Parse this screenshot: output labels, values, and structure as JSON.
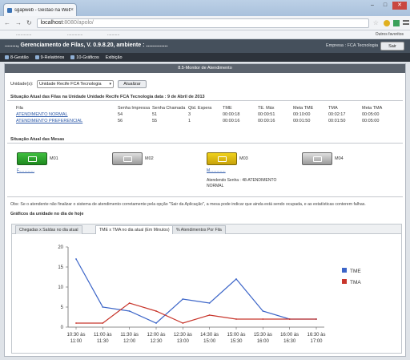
{
  "browser": {
    "tab_title": "sgapweb - Gestão na Web",
    "url_host": "localhost",
    "url_path": ":8080/apolo/",
    "bookmarks": [
      "..............",
      "..............",
      "..........."
    ],
    "other_bookmarks": "Outros favoritos"
  },
  "app": {
    "title": "........, Gerenciamento de Filas, V. 0.9.8.20, ambiente : ..............",
    "empresa": "Empresa : FCA Tecnologia",
    "sair": "Sair",
    "menu": [
      "8-Gestão",
      "9-Relatórios",
      "10-Gráficos",
      "Exibição"
    ]
  },
  "section_title": "8.5-Monitor de Atendimento",
  "filters": {
    "unidade_label": "Unidade(s):",
    "unidade_value": "Unidade Recife FCA Tecnologia",
    "atualizar": "Atualizar"
  },
  "queues": {
    "heading": "Situação Atual das Filas na Unidade Unidade Recife FCA Tecnologia data : 9 de Abril de 2013",
    "headers": [
      "Fila",
      "Senha Impressa",
      "Senha Chamada",
      "Qtd. Espera",
      "TME",
      "TE. Máx",
      "Meta TME",
      "TMA",
      "Meta TMA"
    ],
    "rows": [
      [
        "ATENDIMENTO NORMAL",
        "54",
        "51",
        "3",
        "00:00:18",
        "00:00:51",
        "00:10:00",
        "00:02:17",
        "00:05:00"
      ],
      [
        "ATENDIMENTO PREFERENCIAL",
        "56",
        "55",
        "1",
        "00:00:16",
        "00:00:16",
        "00:01:50",
        "00:01:50",
        "00:05:00"
      ]
    ]
  },
  "desks": {
    "heading": "Situação Atual das Mesas",
    "items": [
      {
        "name": "M01",
        "status": "free",
        "link": "F.............."
      },
      {
        "name": "M02",
        "status": "off",
        "link": ""
      },
      {
        "name": "M03",
        "status": "busy",
        "link": "M..............",
        "info": "Atendendo Senha : 48-ATENDIMENTO NORMAL"
      },
      {
        "name": "M04",
        "status": "off",
        "link": ""
      }
    ]
  },
  "obs": "Obs: Se o atendente não finalizar o sistema de atendimento corretamente pela opção \"Sair da Aplicação\", a mesa pode indicar que ainda está sendo ocupada, e as estatísticas conterem falhas.",
  "graphs": {
    "heading": "Gráficos da unidade no dia de hoje",
    "tabs": [
      "Chegadas x Saídas no dia atual",
      "TME x TMA no dia atual (Em Minutos)",
      "% Atendimentos Por Fila"
    ]
  },
  "colors": {
    "tme": "#3c65c8",
    "tma": "#c8362c"
  },
  "chart_data": {
    "type": "line",
    "categories": [
      "10:30 às 11:00",
      "11:00 às 11:30",
      "11:30 às 12:00",
      "12:00 às 12:30",
      "12:30 às 13:00",
      "14:30 às 15:00",
      "15:00 às 15:30",
      "15:30 às 16:00",
      "16:00 às 16:30",
      "16:30 às 17:00"
    ],
    "series": [
      {
        "name": "TME",
        "values": [
          17,
          5,
          4,
          1,
          7,
          6,
          12,
          4,
          2,
          2
        ]
      },
      {
        "name": "TMA",
        "values": [
          1,
          1,
          6,
          4,
          1,
          3,
          2,
          2,
          2,
          2
        ]
      }
    ],
    "ylim": [
      0,
      20
    ],
    "yticks": [
      0,
      5,
      10,
      15,
      20
    ],
    "legend_position": "right",
    "grid": false
  }
}
